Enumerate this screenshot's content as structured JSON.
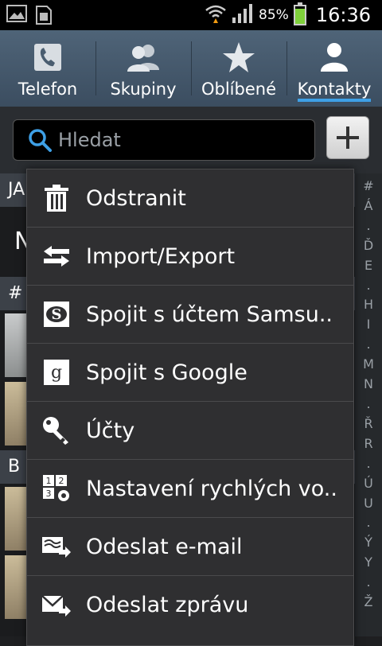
{
  "status_bar": {
    "battery": "85%",
    "time": "16:36",
    "battery_level": 0.85
  },
  "tabs": [
    {
      "label": "Telefon",
      "icon": "phone-icon",
      "active": false
    },
    {
      "label": "Skupiny",
      "icon": "group-icon",
      "active": false
    },
    {
      "label": "Oblíbené",
      "icon": "star-icon",
      "active": false
    },
    {
      "label": "Kontakty",
      "icon": "contact-icon",
      "active": true
    }
  ],
  "search": {
    "placeholder": "Hledat"
  },
  "add_button": {
    "label": "+"
  },
  "background_list": {
    "sections": [
      "JA",
      "#",
      "B"
    ],
    "contact_initial": "N"
  },
  "index_letters": [
    "#",
    "Á",
    ".",
    "Ď",
    "E",
    ".",
    "H",
    "I",
    ".",
    "M",
    "N",
    ".",
    "Ř",
    "R",
    ".",
    "Ú",
    "U",
    ".",
    "Ý",
    "Y",
    ".",
    "Ž"
  ],
  "menu": {
    "items": [
      {
        "label": "Odstranit",
        "icon": "trash-icon"
      },
      {
        "label": "Import/Export",
        "icon": "import-export-icon"
      },
      {
        "label": "Spojit s účtem Samsu..",
        "icon": "samsung-account-icon"
      },
      {
        "label": "Spojit s Google",
        "icon": "google-icon"
      },
      {
        "label": "Účty",
        "icon": "accounts-key-icon"
      },
      {
        "label": "Nastavení rychlých vo..",
        "icon": "speed-dial-icon"
      },
      {
        "label": "Odeslat e-mail",
        "icon": "send-email-icon"
      },
      {
        "label": "Odeslat zprávu",
        "icon": "send-message-icon"
      }
    ]
  },
  "colors": {
    "tab_active_underline": "#3ea0e6",
    "battery_fill": "#7fd13b"
  }
}
